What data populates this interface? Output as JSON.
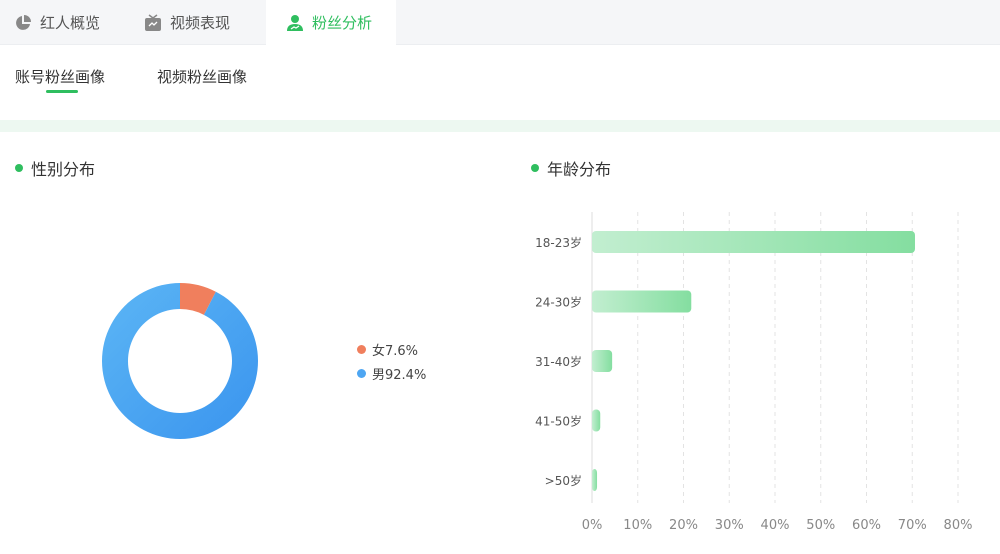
{
  "tabs": [
    {
      "label": "红人概览",
      "icon": "pie-chart-icon"
    },
    {
      "label": "视频表现",
      "icon": "tv-icon"
    },
    {
      "label": "粉丝分析",
      "icon": "user-icon",
      "active": true
    }
  ],
  "subtabs": [
    {
      "label": "账号粉丝画像",
      "active": true
    },
    {
      "label": "视频粉丝画像"
    }
  ],
  "gender": {
    "title": "性别分布",
    "legend": [
      {
        "label": "女7.6%",
        "value": 7.6,
        "color": "#f07f5d"
      },
      {
        "label": "男92.4%",
        "value": 92.4,
        "color": "#4ea6f2"
      }
    ]
  },
  "chart_data": {
    "type": "bar",
    "title": "年龄分布",
    "orientation": "horizontal",
    "categories": [
      "18-23岁",
      "24-30岁",
      "31-40岁",
      "41-50岁",
      ">50岁"
    ],
    "values": [
      70.6,
      21.7,
      4.4,
      1.8,
      1.1
    ],
    "xlim": [
      0,
      80
    ],
    "xticks": [
      "0%",
      "10%",
      "20%",
      "30%",
      "40%",
      "50%",
      "60%",
      "70%",
      "80%"
    ],
    "grid": "vertical-dashed"
  }
}
